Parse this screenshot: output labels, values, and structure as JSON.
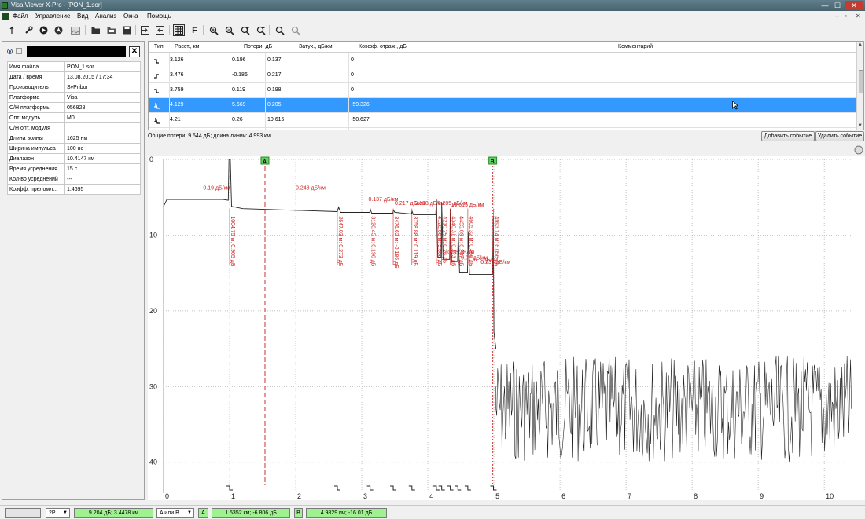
{
  "window": {
    "title": "Visa Viewer X-Pro - [PON_1.sor]",
    "min": "—",
    "max": "☐",
    "close": "✕"
  },
  "menu": [
    "Файл",
    "Управление",
    "Вид",
    "Анализ",
    "Окна",
    "Помощь"
  ],
  "mdi_controls": [
    "–",
    "▫",
    "✕"
  ],
  "toolbar": [
    "pointer-icon",
    "wrench-icon",
    "play-icon",
    "navigate-icon",
    "image-icon",
    "open-folder-icon",
    "folder-icon",
    "save-icon",
    "export-icon",
    "import-icon",
    "grid-icon",
    "font-icon",
    "zoom-in-icon",
    "zoom-out-icon",
    "zoom-plus-icon",
    "zoom-minus-icon",
    "search-icon",
    "search-reset-icon"
  ],
  "left": {
    "close": "✕",
    "props": [
      {
        "k": "Имя файла",
        "v": "PON_1.sor"
      },
      {
        "k": "Дата / время",
        "v": "13.08.2015 / 17:34"
      },
      {
        "k": "Производитель",
        "v": "SvPribor"
      },
      {
        "k": "Платформа",
        "v": "Visa"
      },
      {
        "k": "С/Н платформы",
        "v": "056828"
      },
      {
        "k": "Опт. модуль",
        "v": "M0"
      },
      {
        "k": "С/Н опт. модуля",
        "v": ""
      },
      {
        "k": "Длина волны",
        "v": "1625 нм"
      },
      {
        "k": "Ширина импульса",
        "v": "100 нс"
      },
      {
        "k": "Диапазон",
        "v": "10.4147 км"
      },
      {
        "k": "Время усреднения",
        "v": "15 с"
      },
      {
        "k": "Кол-во усреднений",
        "v": "---"
      },
      {
        "k": "Коэфф. преломл...",
        "v": "1.4695"
      }
    ]
  },
  "events": {
    "headers": [
      "Тип",
      "Расст., км",
      "Потери, дБ",
      "Затух., дБ/км",
      "Коэфф. отраж., дБ",
      "Комментарий"
    ],
    "rows": [
      {
        "type": "splice-down",
        "dist": "3.126",
        "loss": "0.196",
        "att": "0.137",
        "refl": "0",
        "comment": ""
      },
      {
        "type": "splice-up",
        "dist": "3.476",
        "loss": "-0.186",
        "att": "0.217",
        "refl": "0",
        "comment": ""
      },
      {
        "type": "splice-down",
        "dist": "3.759",
        "loss": "0.119",
        "att": "0.198",
        "refl": "0",
        "comment": ""
      },
      {
        "type": "reflect",
        "dist": "4.129",
        "loss": "5.669",
        "att": "0.205",
        "refl": "-59.326",
        "comment": ""
      },
      {
        "type": "reflect",
        "dist": "4.21",
        "loss": "0.26",
        "att": "10.615",
        "refl": "-50.627",
        "comment": ""
      }
    ],
    "selected_row": 3,
    "summary": "Общие потери: 9.544 дБ; длина линии: 4.993 км",
    "add_button": "Добавить событие",
    "delete_button": "Удалить событие"
  },
  "chart_data": {
    "type": "line",
    "xlim": [
      0,
      10.4147
    ],
    "ylim": [
      0,
      42
    ],
    "y_inverted": true,
    "grid": true,
    "x_ticks": [
      "0",
      "1",
      "2",
      "3",
      "4",
      "5",
      "6",
      "7",
      "8",
      "9",
      "10"
    ],
    "y_ticks": [
      "0",
      "10",
      "20",
      "30",
      "40"
    ],
    "markers": [
      {
        "name": "A",
        "x": 1.5352
      },
      {
        "name": "B",
        "x": 4.9829
      }
    ],
    "attenuation_labels": [
      {
        "text": "0.19 дБ/км",
        "x": 0.6,
        "y": 4
      },
      {
        "text": "0.248 дБ/км",
        "x": 2.0,
        "y": 4
      },
      {
        "text": "0.137 дБ/км",
        "x": 3.1,
        "y": 5.5
      },
      {
        "text": "0.217 дБ/км",
        "x": 3.5,
        "y": 6
      },
      {
        "text": "0.198 дБ/км",
        "x": 3.8,
        "y": 6
      },
      {
        "text": "0.205 дБ/км",
        "x": 4.15,
        "y": 6
      },
      {
        "text": "10.615 дБ/км",
        "x": 4.35,
        "y": 6.2
      },
      {
        "text": "0.?6 дБ/км",
        "x": 4.3,
        "y": 12.5
      },
      {
        "text": "0.?? дБ/км",
        "x": 4.5,
        "y": 13.2
      },
      {
        "text": "0.? дБ/км",
        "x": 4.7,
        "y": 13.5
      },
      {
        "text": "0.23? дБ/км",
        "x": 4.8,
        "y": 13.8
      }
    ],
    "event_labels": [
      {
        "text": "1004.75 м: 0.905 дБ",
        "x": 1.0
      },
      {
        "text": "2647.03 м: 0.273 дБ",
        "x": 2.63
      },
      {
        "text": "3126.45 м: 0.196 дБ",
        "x": 3.126
      },
      {
        "text": "3476.62 м: -0.186 дБ",
        "x": 3.476
      },
      {
        "text": "3758.88 м: 0.119 дБ",
        "x": 3.759
      },
      {
        "text": "4128.66 м: 5.668 дБ",
        "x": 4.129
      },
      {
        "text": "4210.25 м: 0.26 дБ",
        "x": 4.21
      },
      {
        "text": "4340.31 м: 0.323 дБ",
        "x": 4.34
      },
      {
        "text": "4455.09 м: 0.297 дБ",
        "x": 4.455
      },
      {
        "text": "4605.32 м: 0.466 дБ",
        "x": 4.605
      },
      {
        "text": "4993.14 м: 6.056 дБ",
        "x": 4.993
      }
    ],
    "trace": [
      [
        0,
        6.2
      ],
      [
        0.05,
        5.3
      ],
      [
        0.9,
        5.3
      ],
      [
        0.98,
        5.4
      ],
      [
        0.99,
        0
      ],
      [
        1.01,
        0
      ],
      [
        1.03,
        6.2
      ],
      [
        1.2,
        6.5
      ],
      [
        2.63,
        6.9
      ],
      [
        2.65,
        6.3
      ],
      [
        2.68,
        7.0
      ],
      [
        3.12,
        7.0
      ],
      [
        3.13,
        6.6
      ],
      [
        3.15,
        7.1
      ],
      [
        3.47,
        7.1
      ],
      [
        3.48,
        6.7
      ],
      [
        3.5,
        7.0
      ],
      [
        3.75,
        7.2
      ],
      [
        3.76,
        6.8
      ],
      [
        3.78,
        7.3
      ],
      [
        4.12,
        7.3
      ],
      [
        4.13,
        5.2
      ],
      [
        4.15,
        12.9
      ],
      [
        4.2,
        12.9
      ],
      [
        4.21,
        5.8
      ],
      [
        4.23,
        13.2
      ],
      [
        4.33,
        13.2
      ],
      [
        4.34,
        6.5
      ],
      [
        4.36,
        13.5
      ],
      [
        4.45,
        13.5
      ],
      [
        4.46,
        9.6
      ],
      [
        4.48,
        15.0
      ],
      [
        4.6,
        15.0
      ],
      [
        4.61,
        9.5
      ],
      [
        4.63,
        15.2
      ],
      [
        4.98,
        15.2
      ],
      [
        4.99,
        7.5
      ],
      [
        5.0,
        22.8
      ],
      [
        5.03,
        25.0
      ]
    ],
    "noise_range": [
      5.03,
      10.4147,
      26,
      40
    ]
  },
  "statusbar": {
    "blank": "",
    "trace_select": "2P",
    "loss_readout": "9.204 дБ; 3.4478 км",
    "mode_select": "A или B",
    "a_label": "A",
    "a_readout": "1.5352 км; -6.806 дБ",
    "b_label": "B",
    "b_readout": "4.9829 км; -16.01 дБ",
    "dropdown": "▼"
  }
}
